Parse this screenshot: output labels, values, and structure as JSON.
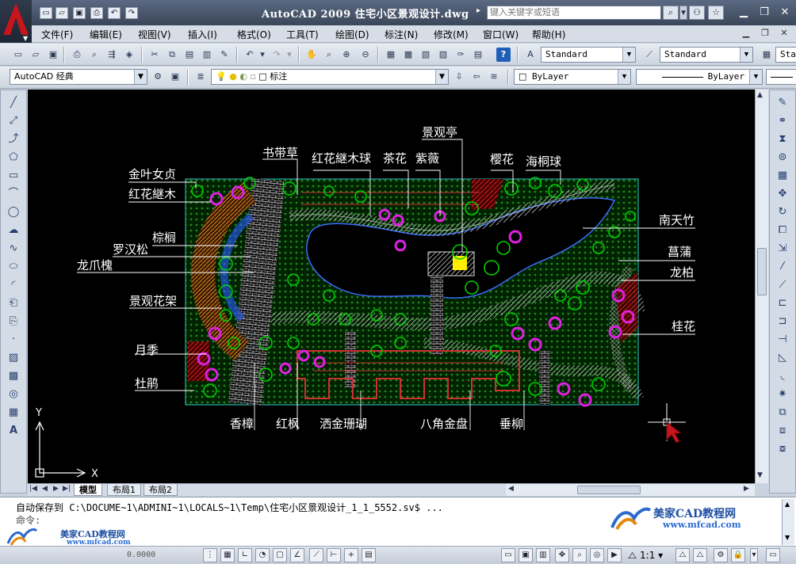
{
  "title": {
    "text": "AutoCAD 2009 住宅小区景观设计.dwg",
    "search_placeholder": "键入关键字或短语"
  },
  "menu": [
    "文件(F)",
    "编辑(E)",
    "视图(V)",
    "插入(I)",
    "格式(O)",
    "工具(T)",
    "绘图(D)",
    "标注(N)",
    "修改(M)",
    "窗口(W)",
    "帮助(H)"
  ],
  "toolbar": {
    "text_style": "Standard",
    "dim_style": "Standard",
    "table_style_partial": "Sta"
  },
  "toolbar2": {
    "workspace": "AutoCAD 经典",
    "layer": "标注",
    "color": "ByLayer",
    "linetype": "ByLayer"
  },
  "plants": {
    "jingguanting": "景观亭",
    "shudaicao": "书带草",
    "honghuajimuqiu": "红花継木球",
    "chahua": "茶花",
    "ziwei": "紫薇",
    "yinghua": "樱花",
    "haitongqiu": "海桐球",
    "jinyenvzhen": "金叶女贞",
    "honghuajimu": "红花継木",
    "zonglv": "棕榈",
    "luohansong": "罗汉松",
    "longzhuahuai": "龙爪槐",
    "jingguanhuajia": "景观花架",
    "yueji": "月季",
    "dujuan": "杜鹃",
    "nantianzhu": "南天竹",
    "changpu": "菖蒲",
    "longbai": "龙柏",
    "guihua": "桂花",
    "xiangzhang": "香樟",
    "hongfeng": "红枫",
    "sajinshanhu": "洒金珊瑚",
    "bajiaojinpan": "八角金盘",
    "chuiliu": "垂柳"
  },
  "axis": {
    "y": "Y",
    "x": "X"
  },
  "tabs": [
    "模型",
    "布局1",
    "布局2"
  ],
  "command": {
    "line1": "自动保存到 C:\\DOCUME~1\\ADMINI~1\\LOCALS~1\\Temp\\住宅小区景观设计_1_1_5552.sv$ ...",
    "prompt": "命令:"
  },
  "watermark": {
    "name": "美家CAD教程网",
    "url": "www.mfcad.com"
  },
  "status": {
    "coords": "0.0000",
    "scale": "1:1"
  },
  "colors": {
    "bg": "#000000",
    "plant_green": "#00c000",
    "pink": "#e020e0",
    "orange": "#d07a20",
    "accent_red": "#c8141b"
  }
}
